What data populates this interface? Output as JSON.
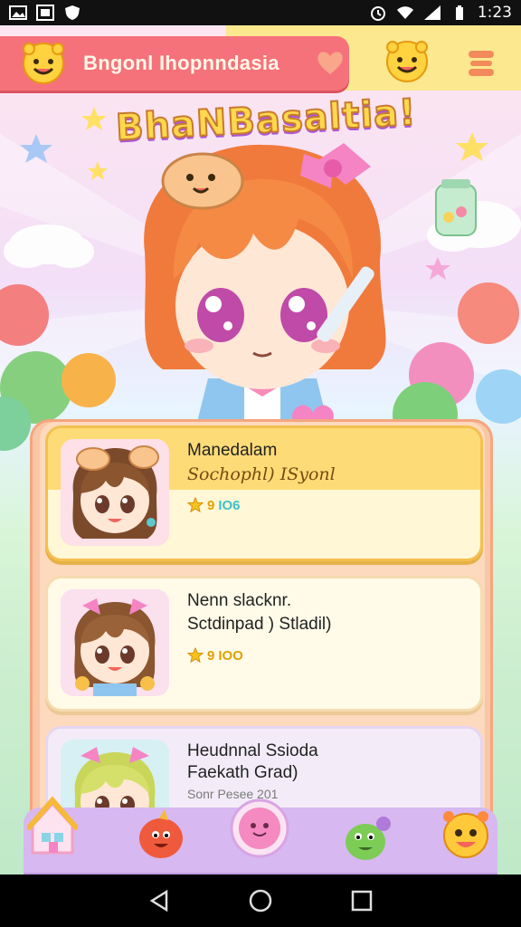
{
  "status_bar": {
    "time": "1:23",
    "icons": [
      "image-icon",
      "gallery-icon",
      "shield-icon",
      "alarm-icon",
      "wifi-icon",
      "signal-icon",
      "battery-icon"
    ]
  },
  "header": {
    "title": "Bngonl Ihopnndasia",
    "icons": [
      "smiley-icon",
      "heart-icon",
      "smiley-icon",
      "menu-icon"
    ]
  },
  "logo_text": "BhaNBasaltia!",
  "cards": [
    {
      "name": "Manedalam",
      "subtitle": "Sochophl) ISyonl",
      "rating": "9",
      "tag": "IO6"
    },
    {
      "name": "Nenn slacknr.",
      "subtitle": "Sctdinpad ) Stladil)",
      "rating": "9",
      "tag": "IOO"
    },
    {
      "name": "Heudnnal Ssioda",
      "subtitle": "Faekath Grad)",
      "meta": "Sonr Pesee 201"
    }
  ],
  "bottom_nav": {
    "items": [
      "home-icon",
      "monster-red-icon",
      "center-face-button",
      "monster-green-icon",
      "monster-yellow-icon"
    ]
  },
  "android_nav": [
    "back-icon",
    "home-circle-icon",
    "recents-icon"
  ],
  "colors": {
    "header_pink": "#f6727a",
    "header_yellow": "#fbe88f",
    "panel": "#f9c7a6",
    "bottom_nav": "#d7b8f0"
  }
}
